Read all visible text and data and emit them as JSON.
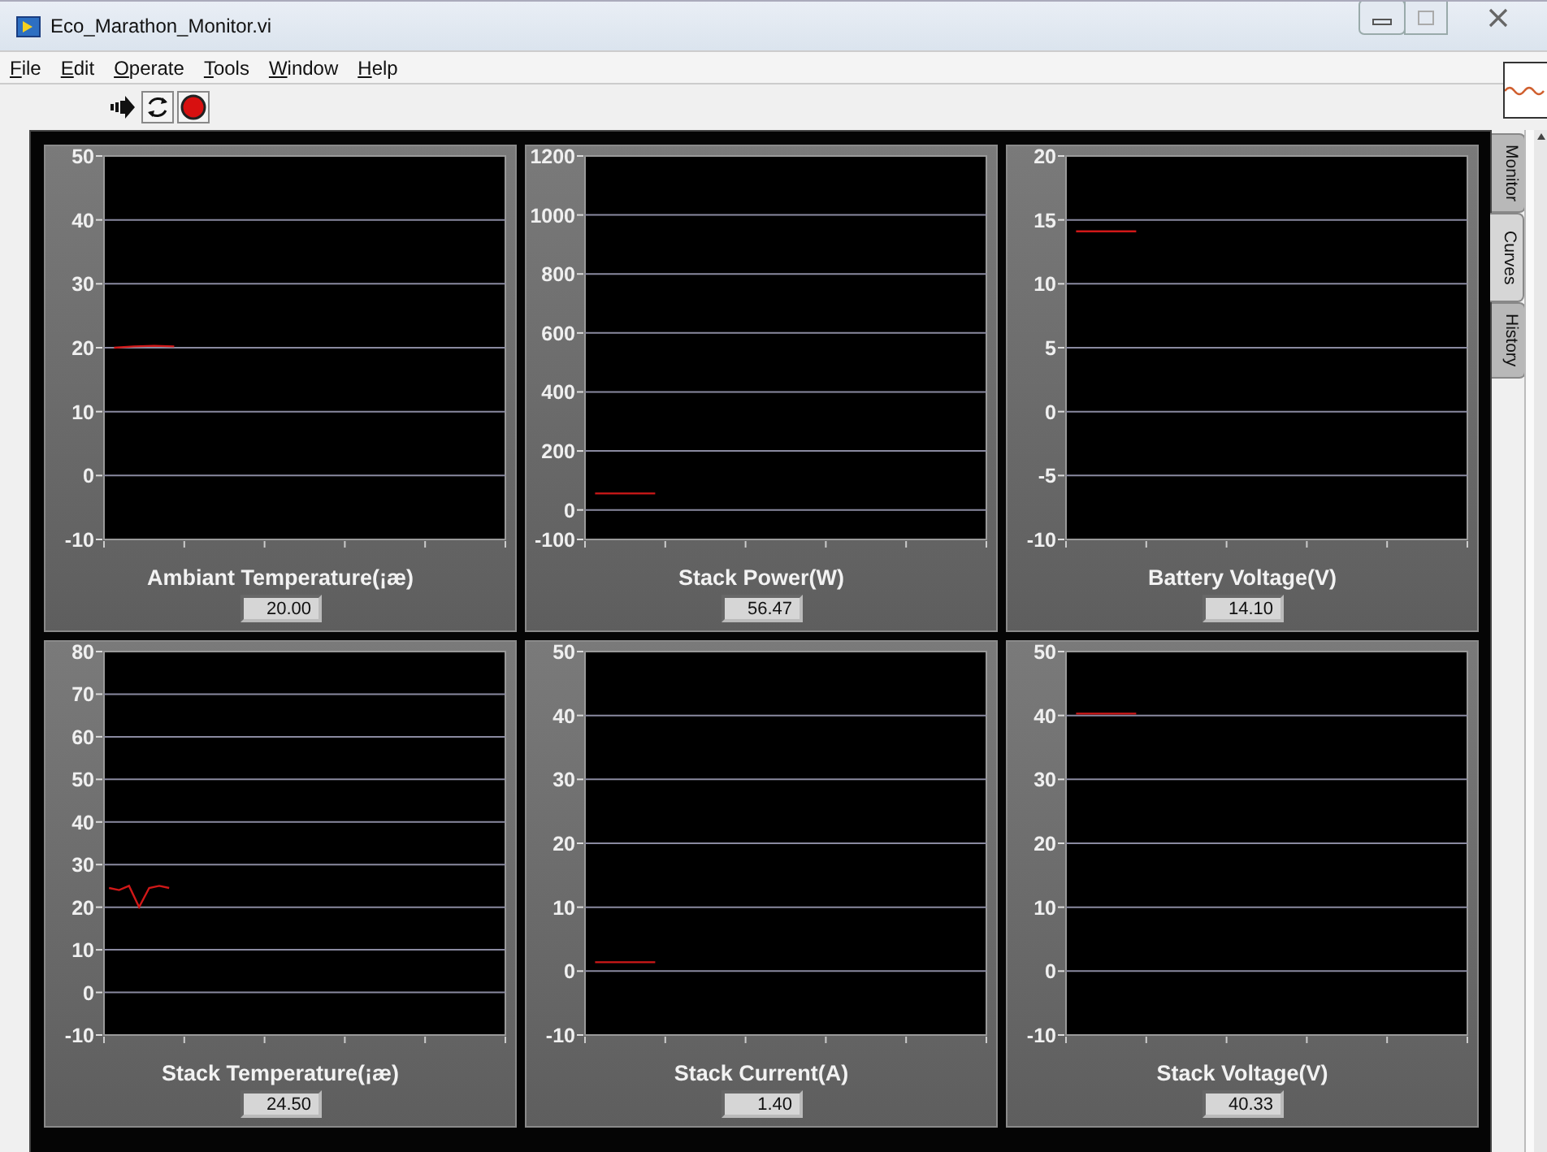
{
  "window": {
    "title": "Eco_Marathon_Monitor.vi"
  },
  "menu": [
    "File",
    "Edit",
    "Operate",
    "Tools",
    "Window",
    "Help"
  ],
  "side_tabs": [
    {
      "label": "Monitor",
      "selected": false
    },
    {
      "label": "Curves",
      "selected": true
    },
    {
      "label": "History",
      "selected": false
    }
  ],
  "panels": [
    {
      "reading": "20.00",
      "chart_data": {
        "type": "line",
        "title": "Ambiant Temperature(¡æ)",
        "grid": true,
        "categories": [
          null,
          null,
          null,
          null,
          null,
          null,
          null,
          null,
          null,
          null,
          null,
          null,
          null,
          null,
          null,
          null,
          null,
          null,
          null,
          null
        ],
        "ylim": [
          -10,
          50
        ],
        "yticks": [
          50,
          40,
          30,
          20,
          10,
          0,
          -10
        ],
        "series": [
          {
            "color": "#d01818",
            "values": [
              20,
              20.2,
              20.3,
              20.2,
              null,
              null,
              null,
              null,
              null,
              null,
              null,
              null,
              null,
              null,
              null,
              null,
              null,
              null,
              null,
              null
            ]
          }
        ]
      }
    },
    {
      "reading": "56.47",
      "chart_data": {
        "type": "line",
        "title": "Stack Power(W)",
        "grid": true,
        "categories": [
          null,
          null,
          null,
          null,
          null,
          null,
          null,
          null,
          null,
          null,
          null,
          null,
          null,
          null,
          null,
          null,
          null,
          null,
          null,
          null
        ],
        "ylim": [
          -100,
          1200
        ],
        "yticks": [
          1200,
          1000,
          800,
          600,
          400,
          200,
          0,
          -100
        ],
        "series": [
          {
            "color": "#d01818",
            "values": [
              56,
              56,
              56,
              56,
              null,
              null,
              null,
              null,
              null,
              null,
              null,
              null,
              null,
              null,
              null,
              null,
              null,
              null,
              null,
              null
            ]
          }
        ]
      }
    },
    {
      "reading": "14.10",
      "chart_data": {
        "type": "line",
        "title": "Battery Voltage(V)",
        "grid": true,
        "categories": [
          null,
          null,
          null,
          null,
          null,
          null,
          null,
          null,
          null,
          null,
          null,
          null,
          null,
          null,
          null,
          null,
          null,
          null,
          null,
          null
        ],
        "ylim": [
          -10,
          20
        ],
        "yticks": [
          20,
          15,
          10,
          5,
          0,
          -5,
          -10
        ],
        "series": [
          {
            "color": "#d01818",
            "values": [
              14.1,
              14.1,
              14.1,
              14.1,
              null,
              null,
              null,
              null,
              null,
              null,
              null,
              null,
              null,
              null,
              null,
              null,
              null,
              null,
              null,
              null
            ]
          }
        ]
      }
    },
    {
      "reading": "24.50",
      "chart_data": {
        "type": "line",
        "title": "Stack Temperature(¡æ)",
        "grid": true,
        "categories": [
          null,
          null,
          null,
          null,
          null,
          null,
          null,
          null,
          null,
          null,
          null,
          null,
          null,
          null,
          null,
          null,
          null,
          null,
          null,
          null,
          null,
          null,
          null,
          null,
          null,
          null,
          null,
          null,
          null,
          null,
          null,
          null,
          null,
          null,
          null,
          null,
          null,
          null,
          null,
          null
        ],
        "ylim": [
          -10,
          80
        ],
        "yticks": [
          80,
          70,
          60,
          50,
          40,
          30,
          20,
          10,
          0,
          -10
        ],
        "series": [
          {
            "color": "#d01818",
            "values": [
              24.5,
              24,
              25,
              20,
              24.5,
              25,
              24.5,
              null,
              null,
              null,
              null,
              null,
              null,
              null,
              null,
              null,
              null,
              null,
              null,
              null,
              null,
              null,
              null,
              null,
              null,
              null,
              null,
              null,
              null,
              null,
              null,
              null,
              null,
              null,
              null,
              null,
              null,
              null,
              null,
              null
            ]
          }
        ]
      }
    },
    {
      "reading": "1.40",
      "chart_data": {
        "type": "line",
        "title": "Stack Current(A)",
        "grid": true,
        "categories": [
          null,
          null,
          null,
          null,
          null,
          null,
          null,
          null,
          null,
          null,
          null,
          null,
          null,
          null,
          null,
          null,
          null,
          null,
          null,
          null
        ],
        "ylim": [
          -10,
          50
        ],
        "yticks": [
          50,
          40,
          30,
          20,
          10,
          0,
          -10
        ],
        "series": [
          {
            "color": "#d01818",
            "values": [
              1.4,
              1.4,
              1.4,
              1.4,
              null,
              null,
              null,
              null,
              null,
              null,
              null,
              null,
              null,
              null,
              null,
              null,
              null,
              null,
              null,
              null
            ]
          }
        ]
      }
    },
    {
      "reading": "40.33",
      "chart_data": {
        "type": "line",
        "title": "Stack Voltage(V)",
        "grid": true,
        "categories": [
          null,
          null,
          null,
          null,
          null,
          null,
          null,
          null,
          null,
          null,
          null,
          null,
          null,
          null,
          null,
          null,
          null,
          null,
          null,
          null
        ],
        "ylim": [
          -10,
          50
        ],
        "yticks": [
          50,
          40,
          30,
          20,
          10,
          0,
          -10
        ],
        "series": [
          {
            "color": "#d01818",
            "values": [
              40.3,
              40.3,
              40.3,
              40.3,
              null,
              null,
              null,
              null,
              null,
              null,
              null,
              null,
              null,
              null,
              null,
              null,
              null,
              null,
              null,
              null
            ]
          }
        ]
      }
    }
  ]
}
